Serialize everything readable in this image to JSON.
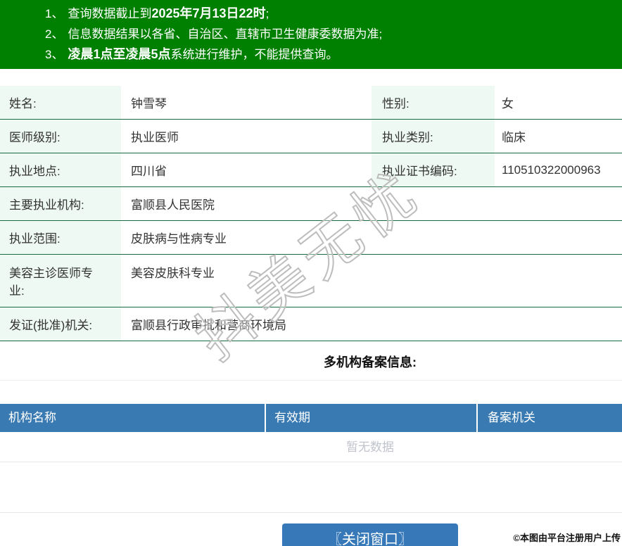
{
  "banner": {
    "notices": [
      {
        "num": "1、",
        "pre": "查询数据截止到",
        "bold": "2025年7月13日22时",
        "post": ";"
      },
      {
        "num": "2、",
        "pre": "信息数据结果以各省、自治区、直辖市卫生健康委数据为准;",
        "bold": "",
        "post": ""
      },
      {
        "num": "3、",
        "pre": "",
        "bold": "凌晨1点至凌晨5点",
        "post": "系统进行维护，不能提供查询。"
      }
    ]
  },
  "info": {
    "rows": [
      {
        "label1": "姓名:",
        "value1": "钟雪琴",
        "label2": "性别:",
        "value2": "女"
      },
      {
        "label1": "医师级别:",
        "value1": "执业医师",
        "label2": "执业类别:",
        "value2": "临床"
      },
      {
        "label1": "执业地点:",
        "value1": "四川省",
        "label2": "执业证书编码:",
        "value2": "110510322000963"
      },
      {
        "label1": "主要执业机构:",
        "value1": "富顺县人民医院"
      },
      {
        "label1": "执业范围:",
        "value1": "皮肤病与性病专业"
      },
      {
        "label1": "美容主诊医师专业:",
        "value1": "美容皮肤科专业"
      },
      {
        "label1": "发证(批准)机关:",
        "value1": "富顺县行政审批和营商环境局"
      }
    ]
  },
  "registration": {
    "heading": "多机构备案信息:",
    "columns": [
      "机构名称",
      "有效期",
      "备案机关"
    ],
    "empty_text": "暂无数据"
  },
  "footer": {
    "close_button": "〖关闭窗口〗"
  },
  "watermark": "抖美无忧",
  "stamp": "©本图由平台注册用户上传",
  "colors": {
    "banner_green": "#008000",
    "row_border_green": "#156b3e",
    "label_bg": "#edf9f2",
    "table_header_blue": "#3a7ab2",
    "button_blue": "#3779b8",
    "empty_text_gray": "#c0c4cc"
  }
}
